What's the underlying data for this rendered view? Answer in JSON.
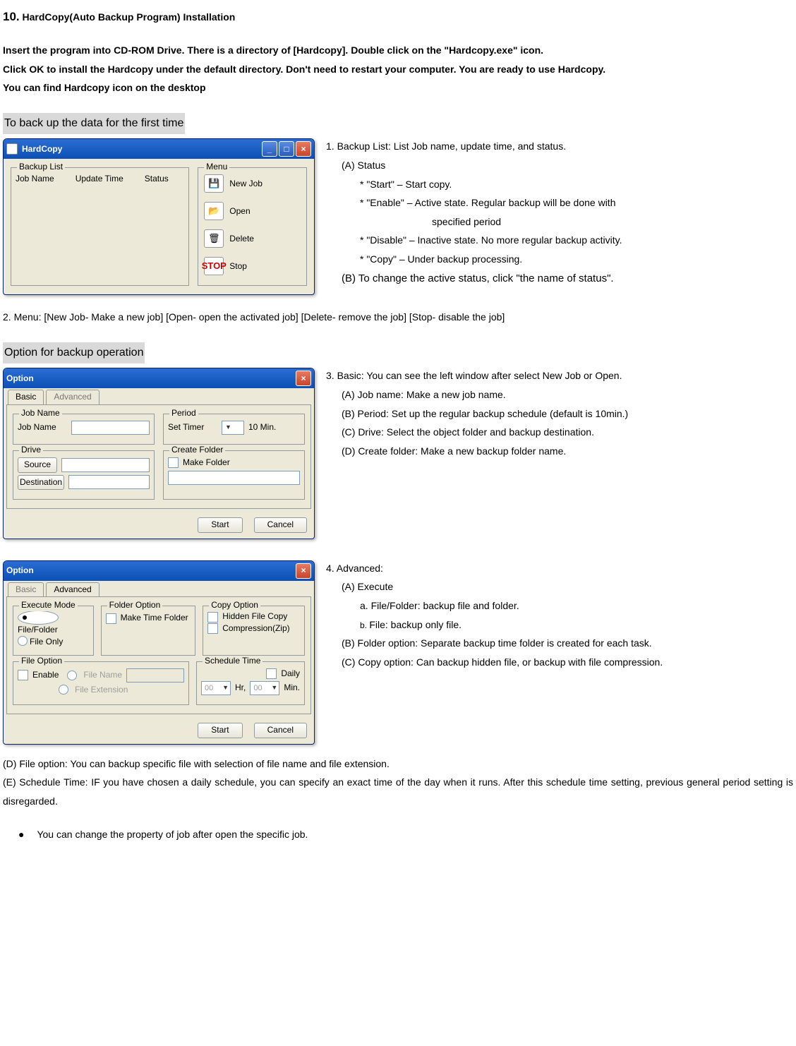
{
  "doc": {
    "heading_num": "10.",
    "heading_text": " HardCopy(Auto Backup Program) Installation",
    "intro1": "Insert the program into CD-ROM Drive. There is a directory of [Hardcopy]. Double click on the \"Hardcopy.exe\" icon.",
    "intro2": "Click OK to install the Hardcopy under the default directory. Don't need to restart your computer. You are ready to use Hardcopy.",
    "intro3": "You can find Hardcopy icon on the desktop",
    "section1_title": "To back up the data for the first time",
    "section2_title": "Option for backup operation",
    "p_menu": "2. Menu: [New Job- Make a new job] [Open- open the activated job] [Delete- remove the job] [Stop- disable the job]",
    "p_d": "(D) File option: You can backup specific file with selection of file name and file extension.",
    "p_e": "(E) Schedule Time: IF you have chosen a daily schedule, you can specify an exact time of the day when it runs. After this schedule time setting, previous general period setting is disregarded.",
    "bullet": "You can change the property of job after open the specific job."
  },
  "right1": {
    "l1": "1. Backup List: List Job name, update time, and status.",
    "l2": "(A) Status",
    "l3": "* \"Start\"    – Start copy.",
    "l4": "* \"Enable\" – Active state. Regular backup will be done with",
    "l4b": "specified period",
    "l5": "* \"Disable\" – Inactive state. No more regular backup activity.",
    "l6": "* \"Copy\"    – Under backup processing.",
    "l7": "(B) To change the active status, click \"the name of status\"."
  },
  "right2": {
    "l1": "3. Basic: You can see the left window after select New Job or Open.",
    "l2": "(A) Job name: Make a new job name.",
    "l3": "(B) Period: Set up the regular backup schedule (default is 10min.)",
    "l4": "(C) Drive: Select the object folder and backup destination.",
    "l5": "(D) Create folder: Make a new backup folder name."
  },
  "right3": {
    "l1": "4. Advanced:",
    "l2": "(A) Execute",
    "l3": "a. File/Folder: backup file and folder.",
    "l4_pre": "b. ",
    "l4": "File: backup only file.",
    "l5": "(B) Folder option: Separate backup time folder is created for each task.",
    "l6": "(C) Copy option: Can backup hidden file, or backup with file compression.",
    "l6b": "compression."
  },
  "dlg1": {
    "title": "HardCopy",
    "grp_list": "Backup List",
    "col_job": "Job Name",
    "col_upd": "Update Time",
    "col_stat": "Status",
    "grp_menu": "Menu",
    "m_new": "New Job",
    "m_open": "Open",
    "m_delete": "Delete",
    "m_stop": "Stop"
  },
  "dlg2": {
    "title": "Option",
    "tab_basic": "Basic",
    "tab_adv": "Advanced",
    "grp_job": "Job Name",
    "lbl_job": "Job Name",
    "grp_period": "Period",
    "lbl_timer": "Set Timer",
    "val_timer": "10 Min.",
    "grp_drive": "Drive",
    "btn_src": "Source",
    "btn_dst": "Destination",
    "grp_create": "Create Folder",
    "chk_make": "Make Folder",
    "btn_start": "Start",
    "btn_cancel": "Cancel"
  },
  "dlg3": {
    "title": "Option",
    "tab_basic": "Basic",
    "tab_adv": "Advanced",
    "grp_exec": "Execute Mode",
    "r_filefolder": "File/Folder",
    "r_fileonly": "File Only",
    "grp_folder": "Folder Option",
    "chk_mtf": "Make Time Folder",
    "grp_copy": "Copy Option",
    "chk_hidden": "Hidden File Copy",
    "chk_zip": "Compression(Zip)",
    "grp_fileopt": "File Option",
    "chk_enable": "Enable",
    "r_fname": "File Name",
    "r_fext": "File Extension",
    "grp_sched": "Schedule Time",
    "chk_daily": "Daily",
    "lbl_hr": "Hr,",
    "lbl_min": "Min.",
    "val_zero": "00",
    "btn_start": "Start",
    "btn_cancel": "Cancel"
  }
}
